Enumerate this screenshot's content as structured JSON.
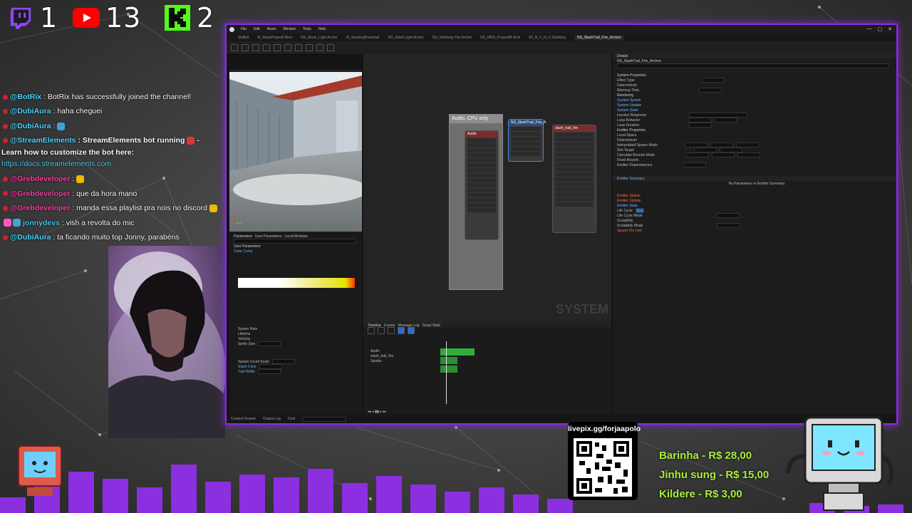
{
  "stats": [
    {
      "platform": "twitch",
      "icon": "twitch-icon",
      "count": "1",
      "color": "#9146ff"
    },
    {
      "platform": "youtube",
      "icon": "youtube-icon",
      "count": "13",
      "color": "#ff0000"
    },
    {
      "platform": "kick",
      "icon": "kick-icon",
      "count": "2",
      "color": "#53fc18"
    }
  ],
  "chat": [
    {
      "user": "@BotRix",
      "text": ": BotRix has successfully joined the channel!"
    },
    {
      "user": "@DubiAura",
      "text": ": haha cheguei"
    },
    {
      "user": "@DubiAura",
      "text": ":"
    },
    {
      "user": "@StreamElements",
      "text": ": StreamElements bot running",
      "text2": "- Learn how to customize the bot here:",
      "link": "https://docs.streamelements.com"
    },
    {
      "user": "@Grebdeveloper",
      "text": ":"
    },
    {
      "user": "@Grebdeveloper",
      "text": ": que da hora mano"
    },
    {
      "user": "@Grebdeveloper",
      "text": ": manda essa playlist pra nois no discord"
    },
    {
      "user": "jonnydevs",
      "text": ": vish a revolta do mic"
    },
    {
      "user": "@DubiAura",
      "text": ": ta ficando muito top Jonny, parabéns"
    }
  ],
  "editor": {
    "tabs": [
      "NS_SlashTrail_Fire_Archon"
    ],
    "graph_comment": "Audio, CPU only",
    "watermark": "SYSTEM",
    "details_title": "NS_SlashTrail_Fire_Archon"
  },
  "overlay": {
    "qr_caption": "livepix.gg/forjaapolo",
    "donations": [
      {
        "name": "Barinha",
        "amount": "R$ 28,00"
      },
      {
        "name": "Jinhu sung",
        "amount": "R$ 15,00"
      },
      {
        "name": "Kildere",
        "amount": "R$ 3,00"
      }
    ],
    "accent_color": "#8a2be2",
    "donation_color": "#a6ef3c"
  }
}
